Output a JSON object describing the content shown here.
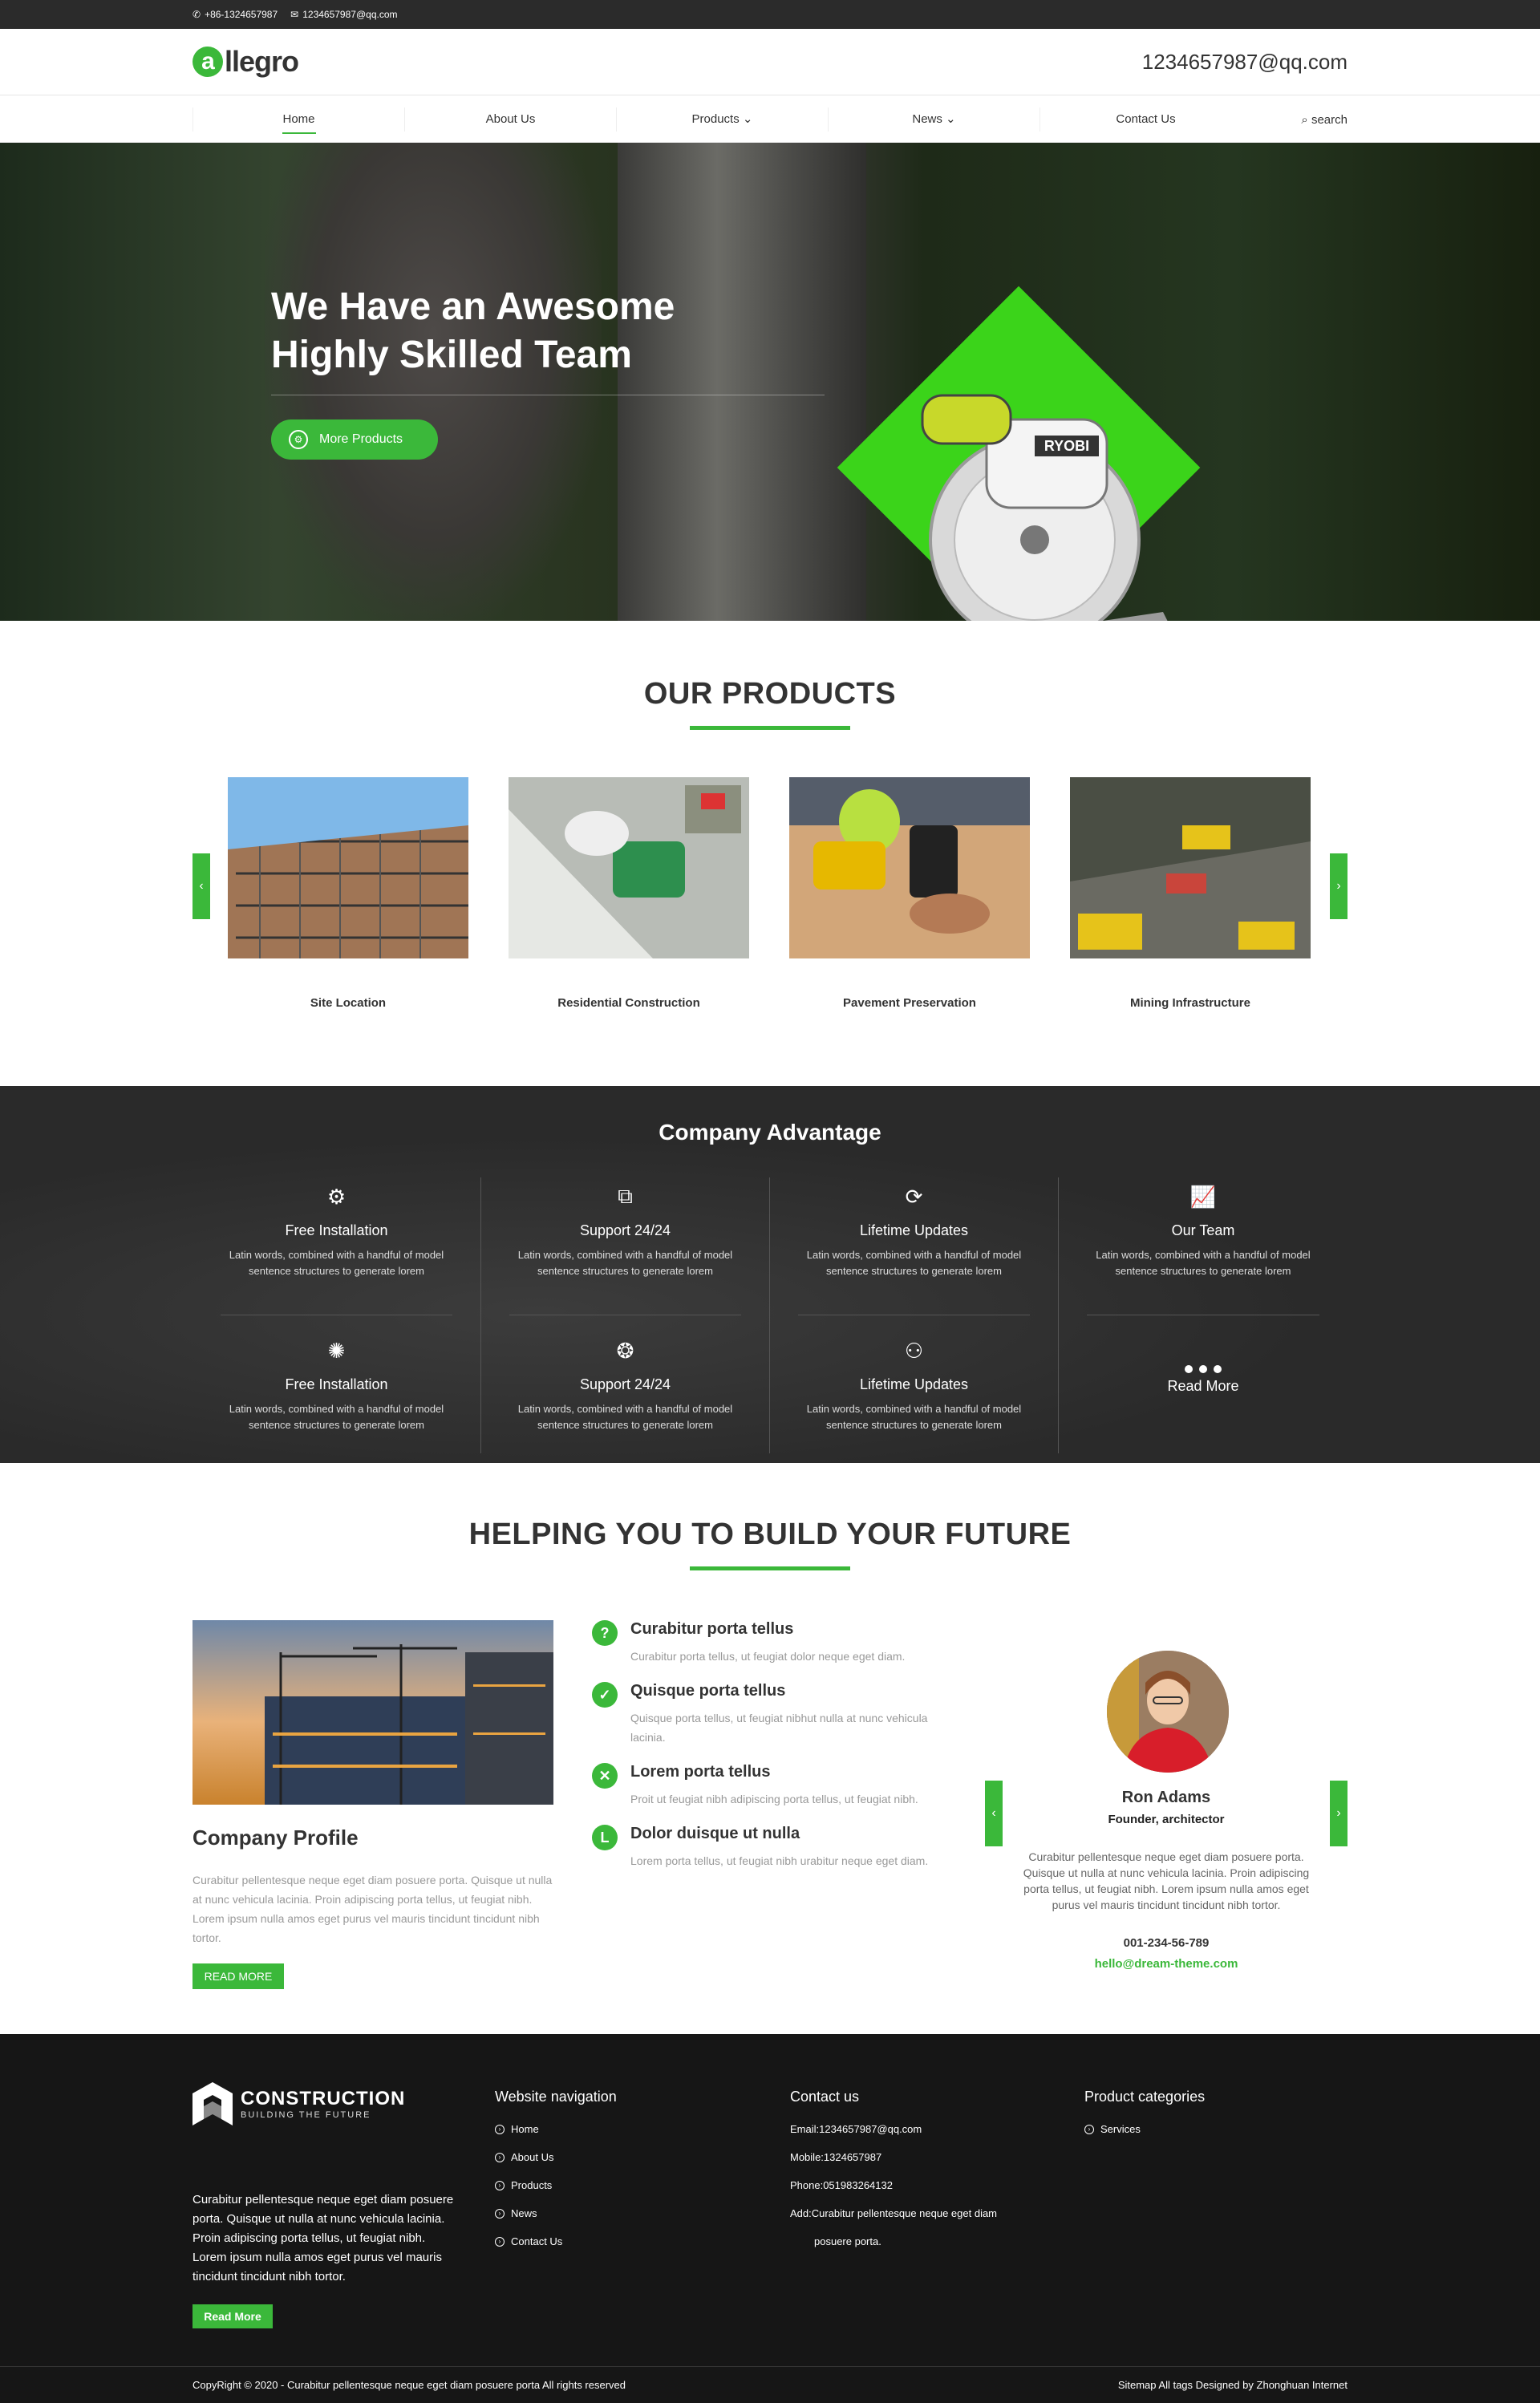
{
  "topbar": {
    "phone": "+86-1324657987",
    "email": "1234657987@qq.com"
  },
  "header": {
    "logo_text": "llegro",
    "logo_letter": "a",
    "email": "1234657987@qq.com"
  },
  "nav": {
    "items": [
      {
        "label": "Home",
        "active": true
      },
      {
        "label": "About Us"
      },
      {
        "label": "Products ⌄"
      },
      {
        "label": "News ⌄"
      },
      {
        "label": "Contact Us"
      }
    ],
    "search": "search"
  },
  "hero": {
    "title_line1": "We Have an Awesome",
    "title_line2": "Highly Skilled Team",
    "button": "More Products",
    "saw_brand": "RYOBI"
  },
  "products": {
    "title": "OUR PRODUCTS",
    "items": [
      {
        "label": "Site Location"
      },
      {
        "label": "Residential Construction"
      },
      {
        "label": "Pavement Preservation"
      },
      {
        "label": "Mining Infrastructure"
      }
    ]
  },
  "advantage": {
    "title": "Company Advantage",
    "items": [
      {
        "title": "Free Installation",
        "desc": "Latin words, combined with a handful of model sentence structures to generate lorem",
        "icon": "gear-icon"
      },
      {
        "title": "Support 24/24",
        "desc": "Latin words, combined with a handful of model sentence structures to generate lorem",
        "icon": "support-icon"
      },
      {
        "title": "Lifetime Updates",
        "desc": "Latin words, combined with a handful of model sentence structures to generate lorem",
        "icon": "update-icon"
      },
      {
        "title": "Our Team",
        "desc": "Latin words, combined with a handful of model sentence structures to generate lorem",
        "icon": "chart-icon"
      },
      {
        "title": "Free Installation",
        "desc": "Latin words, combined with a handful of model sentence structures to generate lorem",
        "icon": "network-icon"
      },
      {
        "title": "Support 24/24",
        "desc": "Latin words, combined with a handful of model sentence structures to generate lorem",
        "icon": "badge-icon"
      },
      {
        "title": "Lifetime Updates",
        "desc": "Latin words, combined with a handful of model sentence structures to generate lorem",
        "icon": "team-icon"
      }
    ],
    "read_more": "Read More"
  },
  "help": {
    "title": "HELPING YOU TO BUILD YOUR FUTURE",
    "profile_title": "Company Profile",
    "profile_text": "Curabitur pellentesque neque eget diam posuere porta. Quisque ut nulla at nunc vehicula lacinia. Proin adipiscing porta tellus, ut feugiat nibh. Lorem ipsum nulla amos eget purus vel mauris tincidunt tincidunt nibh tortor.",
    "profile_button": "READ MORE",
    "faq": [
      {
        "icon": "?",
        "title": "Curabitur porta tellus",
        "text": "Curabitur porta tellus, ut feugiat dolor neque eget diam."
      },
      {
        "icon": "✓",
        "title": "Quisque porta tellus",
        "text": "Quisque porta tellus, ut feugiat nibhut nulla at nunc vehicula lacinia."
      },
      {
        "icon": "✕",
        "title": "Lorem porta tellus",
        "text": "Proit ut feugiat nibh adipiscing porta tellus, ut feugiat nibh."
      },
      {
        "icon": "L",
        "title": "Dolor duisque ut nulla",
        "text": "Lorem porta tellus, ut feugiat nibh urabitur neque eget diam."
      }
    ],
    "testimonial": {
      "name": "Ron Adams",
      "role": "Founder, architector",
      "text": "Curabitur pellentesque neque eget diam posuere porta. Quisque ut nulla at nunc vehicula lacinia. Proin adipiscing porta tellus, ut feugiat nibh. Lorem ipsum nulla amos eget purus vel mauris tincidunt tincidunt nibh tortor.",
      "phone": "001-234-56-789",
      "email": "hello@dream-theme.com"
    }
  },
  "footer": {
    "brand": "CONSTRUCTION",
    "tagline": "BUILDING THE FUTURE",
    "about": "Curabitur pellentesque neque eget diam posuere porta. Quisque ut nulla at nunc vehicula lacinia. Proin adipiscing porta tellus, ut feugiat nibh. Lorem ipsum nulla amos eget purus vel mauris tincidunt tincidunt nibh tortor.",
    "read_more": "Read More",
    "nav_title": "Website navigation",
    "nav_items": [
      "Home",
      "About Us",
      "Products",
      "News",
      "Contact Us"
    ],
    "contact_title": "Contact us",
    "contact_items": [
      "Email:1234657987@qq.com",
      "Mobile:1324657987",
      "Phone:051983264132",
      "Add:Curabitur pellentesque neque eget diam",
      "posuere porta."
    ],
    "cat_title": "Product categories",
    "cat_items": [
      "Services"
    ],
    "copyright": "CopyRight © 2020 -   Curabitur pellentesque neque eget diam posuere porta  All rights reserved",
    "bottom_links": "Sitemap  All tags   Designed by Zhonghuan Internet"
  },
  "colors": {
    "accent": "#3bb83a",
    "dark": "#2a2a2a",
    "footer": "#161616"
  }
}
